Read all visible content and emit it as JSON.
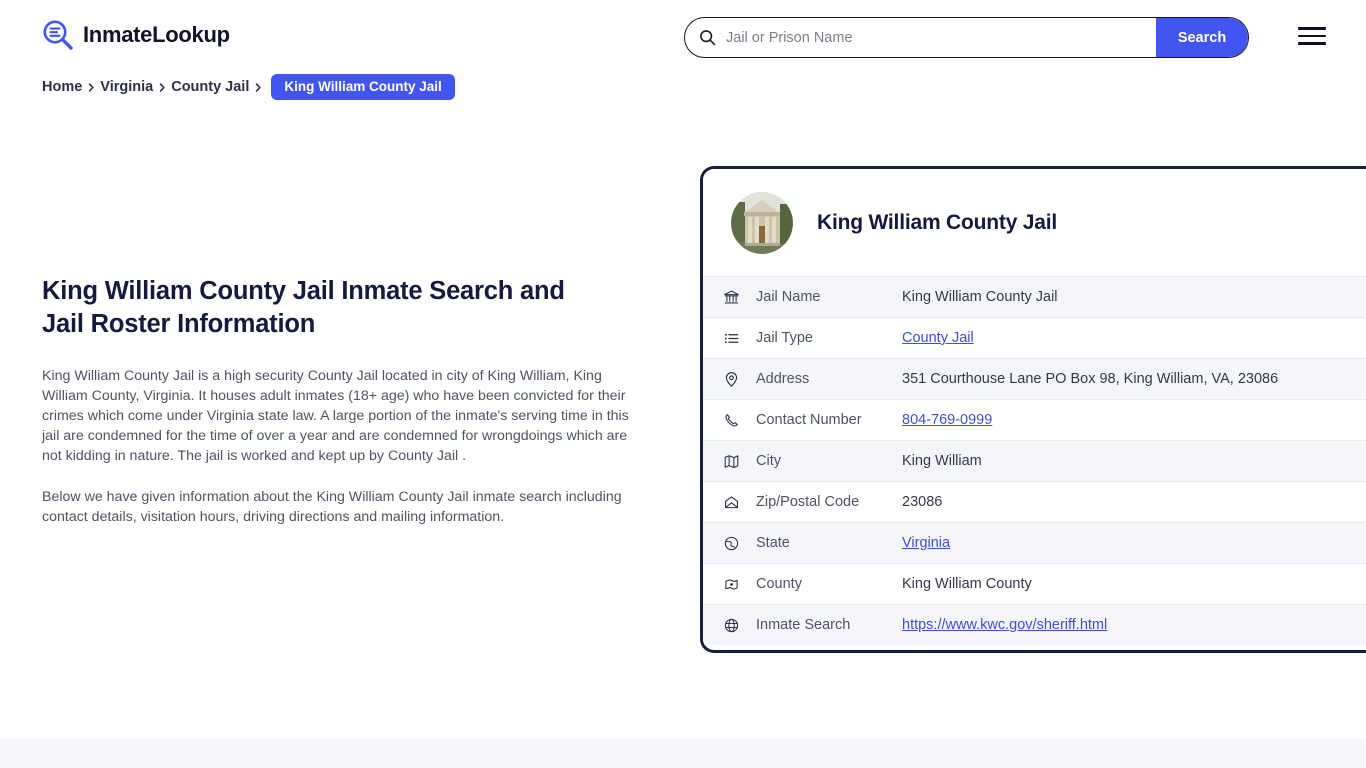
{
  "site": {
    "brand_name": "InmateLookup",
    "brand_icon": "magnifier-list-icon"
  },
  "search": {
    "placeholder": "Jail or Prison Name",
    "value": "",
    "button_label": "Search",
    "icon": "search-icon"
  },
  "menu": {
    "icon": "hamburger-icon"
  },
  "breadcrumb": {
    "items": [
      {
        "label": "Home"
      },
      {
        "label": "Virginia"
      },
      {
        "label": "County Jail"
      }
    ],
    "current": "King William County Jail",
    "separator": "❯"
  },
  "main": {
    "title": "King William County Jail Inmate Search and Jail Roster Information",
    "paragraph_1": "King William County Jail is a high security County Jail located in city of King William, King William County, Virginia. It houses adult inmates (18+ age) who have been convicted for their crimes which come under Virginia state law. A large portion of the inmate's serving time in this jail are condemned for the time of over a year and are condemned for wrongdoings which are not kidding in nature. The jail is worked and kept up by County Jail .",
    "paragraph_2": "Below we have given information about the King William County Jail inmate search including contact details, visitation hours, driving directions and mailing information."
  },
  "card": {
    "avatar_icon": "courthouse-photo",
    "title": "King William County Jail",
    "rows": [
      {
        "icon": "bank-icon",
        "label": "Jail Name",
        "value": "King William County Jail",
        "link": false
      },
      {
        "icon": "list-icon",
        "label": "Jail Type",
        "value": "County Jail",
        "link": true
      },
      {
        "icon": "map-pin-icon",
        "label": "Address",
        "value": "351 Courthouse Lane PO Box 98, King William, VA, 23086",
        "link": false
      },
      {
        "icon": "phone-icon",
        "label": "Contact Number",
        "value": "804-769-0999",
        "link": true
      },
      {
        "icon": "map-icon",
        "label": "City",
        "value": "King William",
        "link": false
      },
      {
        "icon": "envelope-icon",
        "label": "Zip/Postal Code",
        "value": "23086",
        "link": false
      },
      {
        "icon": "globe-pin-icon",
        "label": "State",
        "value": "Virginia",
        "link": true
      },
      {
        "icon": "county-icon",
        "label": "County",
        "value": "King William County",
        "link": false
      },
      {
        "icon": "globe-icon",
        "label": "Inmate Search",
        "value": "https://www.kwc.gov/sheriff.html",
        "link": true
      }
    ]
  },
  "colors": {
    "accent": "#4355f0",
    "link": "#3c4fd6",
    "dark": "#141b3c",
    "row_alt": "#f5f6fc",
    "band": "#f6f6fd"
  }
}
